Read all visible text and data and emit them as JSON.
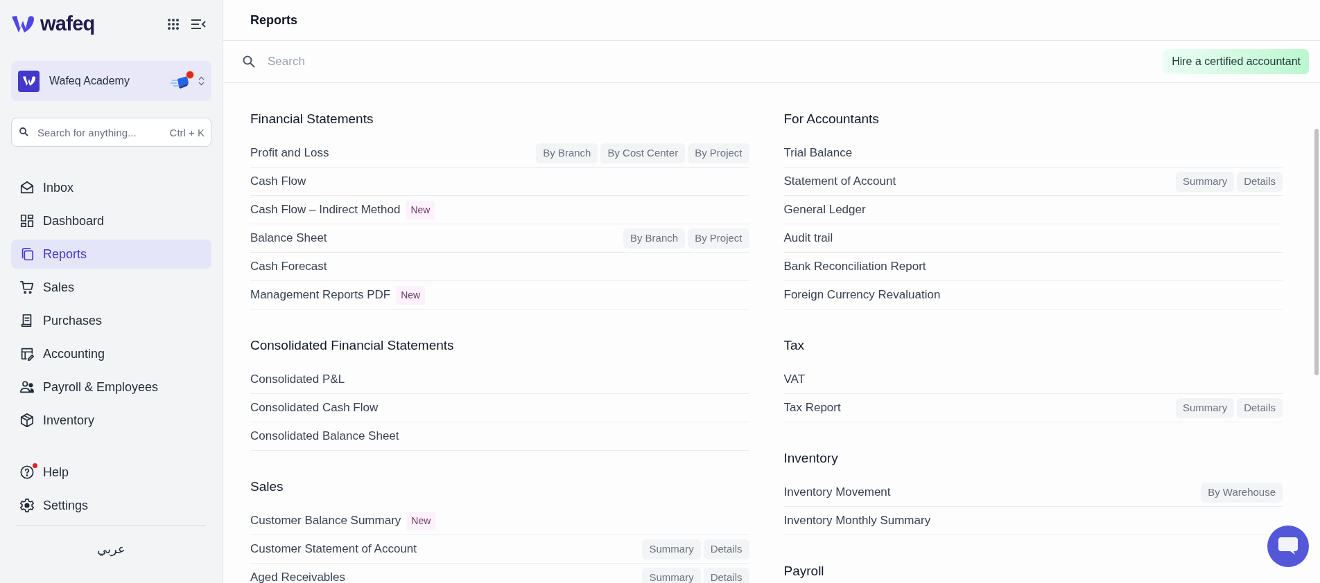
{
  "sidebar": {
    "logo": "wafeq",
    "organization": {
      "name": "Wafeq Academy",
      "alert": true
    },
    "search": {
      "placeholder": "Search for anything...",
      "shortcut": "Ctrl + K"
    },
    "nav": [
      {
        "label": "Inbox",
        "selected": false
      },
      {
        "label": "Dashboard",
        "selected": false
      },
      {
        "label": "Reports",
        "selected": true
      },
      {
        "label": "Sales",
        "selected": false
      },
      {
        "label": "Purchases",
        "selected": false
      },
      {
        "label": "Accounting",
        "selected": false
      },
      {
        "label": "Payroll & Employees",
        "selected": false
      },
      {
        "label": "Inventory",
        "selected": false
      }
    ],
    "footer_nav": [
      {
        "label": "Help",
        "notification": true
      },
      {
        "label": "Settings",
        "notification": false
      }
    ],
    "language": "عربي"
  },
  "header": {
    "title": "Reports"
  },
  "toolbar": {
    "search_placeholder": "Search",
    "hire_button": "Hire a certified accountant"
  },
  "columns": [
    [
      {
        "title": "Financial Statements",
        "items": [
          {
            "label": "Profit and Loss",
            "tags": [
              "By Branch",
              "By Cost Center",
              "By Project"
            ]
          },
          {
            "label": "Cash Flow"
          },
          {
            "label": "Cash Flow – Indirect Method",
            "badge": "New"
          },
          {
            "label": "Balance Sheet",
            "tags": [
              "By Branch",
              "By Project"
            ]
          },
          {
            "label": "Cash Forecast"
          },
          {
            "label": "Management Reports PDF",
            "badge": "New"
          }
        ]
      },
      {
        "title": "Consolidated Financial Statements",
        "items": [
          {
            "label": "Consolidated P&L"
          },
          {
            "label": "Consolidated Cash Flow"
          },
          {
            "label": "Consolidated Balance Sheet"
          }
        ]
      },
      {
        "title": "Sales",
        "items": [
          {
            "label": "Customer Balance Summary",
            "badge": "New"
          },
          {
            "label": "Customer Statement of Account",
            "tags": [
              "Summary",
              "Details"
            ]
          },
          {
            "label": "Aged Receivables",
            "tags": [
              "Summary",
              "Details"
            ]
          }
        ]
      }
    ],
    [
      {
        "title": "For Accountants",
        "items": [
          {
            "label": "Trial Balance"
          },
          {
            "label": "Statement of Account",
            "tags": [
              "Summary",
              "Details"
            ]
          },
          {
            "label": "General Ledger"
          },
          {
            "label": "Audit trail"
          },
          {
            "label": "Bank Reconciliation Report"
          },
          {
            "label": "Foreign Currency Revaluation"
          }
        ]
      },
      {
        "title": "Tax",
        "items": [
          {
            "label": "VAT"
          },
          {
            "label": "Tax Report",
            "tags": [
              "Summary",
              "Details"
            ]
          }
        ]
      },
      {
        "title": "Inventory",
        "items": [
          {
            "label": "Inventory Movement",
            "tags": [
              "By Warehouse"
            ]
          },
          {
            "label": "Inventory Monthly Summary"
          }
        ]
      },
      {
        "title": "Payroll"
      }
    ]
  ]
}
